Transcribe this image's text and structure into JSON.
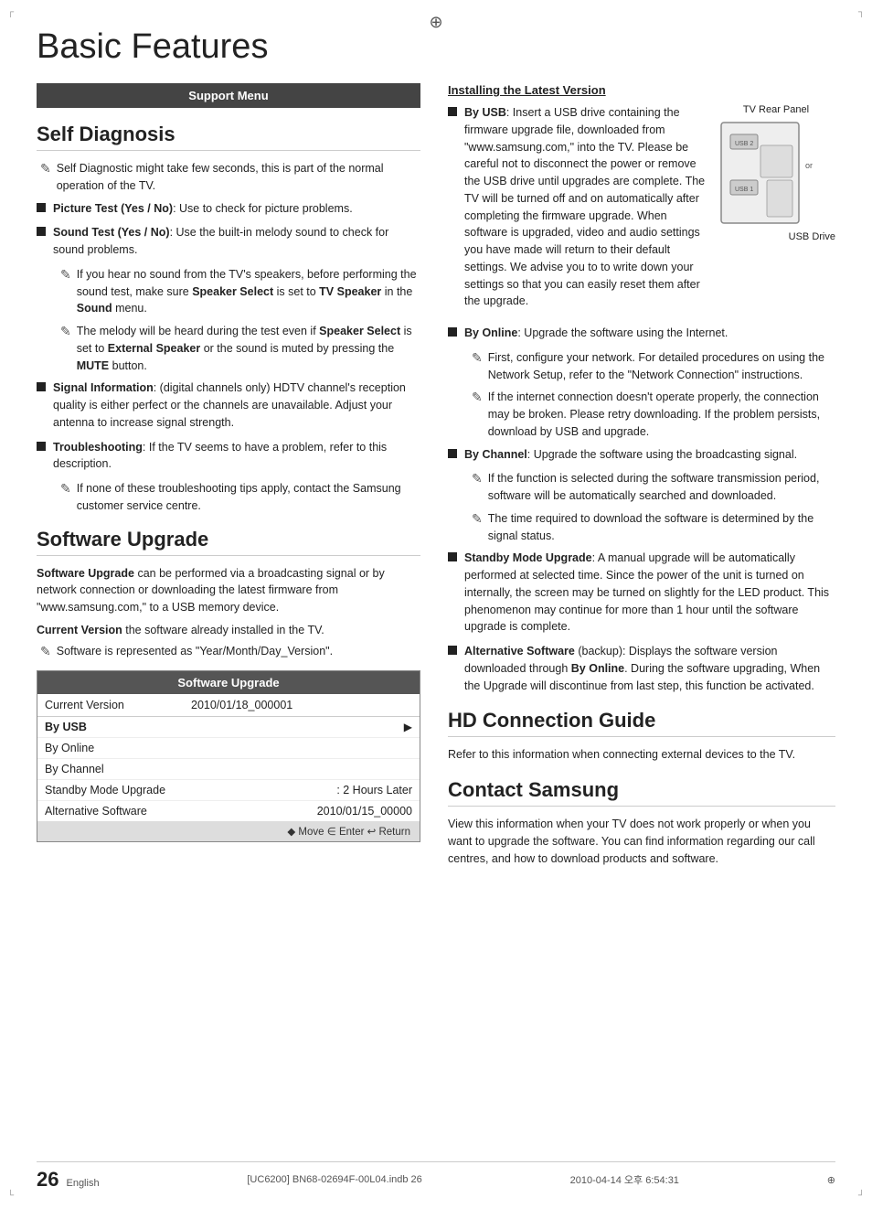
{
  "page": {
    "title": "Basic Features",
    "page_number": "26",
    "language": "English",
    "footer_file": "[UC6200] BN68-02694F-00L04.indb   26",
    "footer_date": "2010-04-14   오후 6:54:31"
  },
  "support_menu": {
    "header": "Support Menu"
  },
  "self_diagnosis": {
    "title": "Self Diagnosis",
    "intro_note": "Self Diagnostic might take few seconds, this is part of the normal operation of the TV.",
    "items": [
      {
        "label": "Picture Test (Yes / No)",
        "text": ": Use to check for picture problems."
      },
      {
        "label": "Sound Test (Yes / No)",
        "text": ": Use the built-in melody sound to check for sound problems."
      },
      {
        "label": "Signal Information",
        "text": ": (digital channels only) HDTV channel's reception quality is either perfect or the channels are unavailable. Adjust your antenna to increase signal strength."
      },
      {
        "label": "Troubleshooting",
        "text": ": If the TV seems to have a problem, refer to this description."
      }
    ],
    "sound_notes": [
      "If you hear no sound from the TV's speakers, before performing the sound test, make sure Speaker Select is set to TV Speaker in the Sound menu.",
      "The melody will be heard during the test even if Speaker Select is set to External Speaker or the sound is muted by pressing the MUTE button."
    ],
    "troubleshooting_note": "If none of these troubleshooting tips apply, contact the Samsung customer service centre."
  },
  "software_upgrade": {
    "title": "Software Upgrade",
    "intro": "Software Upgrade can be performed via a broadcasting signal or by network connection or downloading the latest firmware from \"www.samsung.com,\" to a USB memory device.",
    "current_version_label": "Current Version",
    "current_version_text": " the software already installed in the TV.",
    "note": "Software is represented as \"Year/Month/Day_Version\".",
    "table": {
      "header": "Software Upgrade",
      "current_version_label": "Current Version",
      "current_version_value": "2010/01/18_000001",
      "menu_items": [
        {
          "label": "By USB",
          "has_arrow": true,
          "selected": false
        },
        {
          "label": "By Online",
          "has_arrow": false,
          "selected": false
        },
        {
          "label": "By Channel",
          "has_arrow": false,
          "selected": false
        },
        {
          "label": "Standby Mode Upgrade",
          "value": ": 2 Hours Later",
          "selected": false
        },
        {
          "label": "Alternative Software",
          "value": "2010/01/15_00000",
          "selected": false
        }
      ],
      "footer": "◆ Move   ∈ Enter   ↩ Return"
    }
  },
  "installing_latest": {
    "title": "Installing the Latest Version",
    "tv_rear_panel_label": "TV Rear Panel",
    "usb_drive_label": "USB Drive",
    "or_label": "or",
    "by_usb": {
      "label": "By USB",
      "text": ": Insert a USB drive containing the firmware upgrade file, downloaded from \"www.samsung.com,\" into the TV. Please be careful not to disconnect the power or remove the USB drive until upgrades are complete. The TV will be turned off and on automatically after completing the firmware upgrade. When software is upgraded, video and audio settings you have made will return to their default settings. We advise you to to write down your settings so that you can easily reset them after the upgrade."
    },
    "by_online": {
      "label": "By Online",
      "text": ": Upgrade the software using the Internet.",
      "notes": [
        "First, configure your network. For detailed procedures on using the Network Setup, refer to the \"Network Connection\" instructions.",
        "If the internet connection doesn't operate properly, the connection may be broken. Please retry downloading. If the problem persists, download by USB and upgrade."
      ]
    },
    "by_channel": {
      "label": "By Channel",
      "text": ": Upgrade the software using the broadcasting signal.",
      "notes": [
        "If the function is selected during the software transmission period, software will be automatically searched and downloaded.",
        "The time required to download the software is determined by the signal status."
      ]
    },
    "standby_mode": {
      "label": "Standby Mode Upgrade",
      "text": ": A manual upgrade will be automatically performed at selected time. Since the power of the unit is turned on internally, the screen may be turned on slightly for the LED product. This phenomenon may continue for more than 1 hour until the software upgrade is complete."
    },
    "alternative_software": {
      "label": "Alternative Software",
      "text": " (backup): Displays the software version downloaded through By Online. During the software upgrading, When the Upgrade will discontinue from last step, this function be activated."
    }
  },
  "hd_connection": {
    "title": "HD Connection Guide",
    "text": "Refer to this information when connecting external devices to the TV."
  },
  "contact_samsung": {
    "title": "Contact Samsung",
    "text": "View this information when your TV does not work properly or when you want to upgrade the software. You can find information regarding our call centres, and how to download products and software."
  }
}
